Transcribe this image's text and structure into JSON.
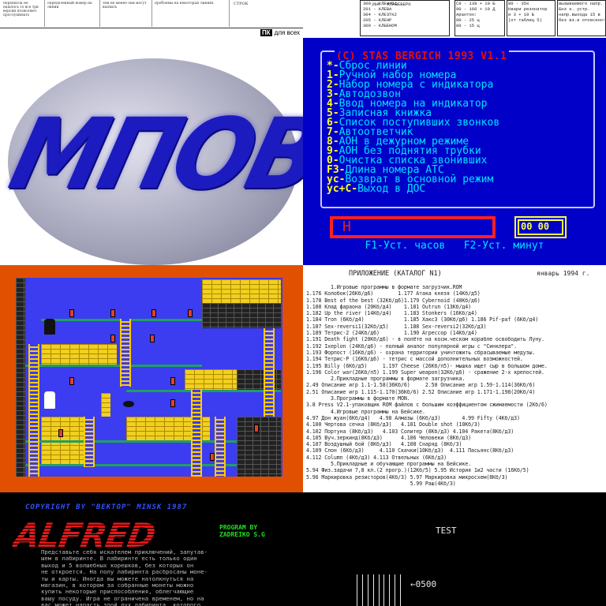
{
  "newsprint": {
    "lines": [
      "переписок не нашлось то все три версии позволяют прослушивать",
      "определенный номер на линии",
      "тем не менее они могут вызвать",
      "проблемы на некоторых линиях"
    ],
    "table_rows": [
      "",
      "",
      "",
      "СТРОК",
      "",
      ""
    ],
    "brand": "ПК",
    "brand_suffix": "для всех"
  },
  "handwritten_table": {
    "col1": [
      "300 - КЛЕН461",
      "201 - КЛЕВА",
      "304 - КЛЕЗТК2",
      "205 - КЛЕНР",
      "309 - КЛБЕНОМ"
    ],
    "col2": [
      "20А - КЛАВЕВЕРО"
    ],
    "col3": [
      "С9 - 139 + 10 Б",
      "90 - 160 + 10 Д",
      "Арантон:",
      "80 - 25 ц",
      "80 - 15 ц"
    ],
    "col4": [
      "80 - 35к",
      "Квари резонатор",
      "и 3 + 10 Б",
      "(от таблиц 5)"
    ],
    "col5": [
      "вызываемого напр.",
      "Бнз к. устр.",
      "напр.выхода 15 в",
      "без вз.и отнесено!"
    ]
  },
  "logo": {
    "text": "МПОВТ"
  },
  "menu": {
    "title": "(C) STAS BERGICH  1993  V1.1",
    "items": [
      {
        "key": "*-",
        "label": "Сброс линии"
      },
      {
        "key": "1-",
        "label": "Ручной набор номера"
      },
      {
        "key": "2-",
        "label": "Набор номера с индикатора"
      },
      {
        "key": "3-",
        "label": "Автодозвон"
      },
      {
        "key": "4-",
        "label": "Ввод номера на индикатор"
      },
      {
        "key": "5-",
        "label": "Записная книжка"
      },
      {
        "key": "6-",
        "label": "Список поступивших звонков"
      },
      {
        "key": "7-",
        "label": "Автоответчик"
      },
      {
        "key": "8-",
        "label": "АОН в дежурном режиме"
      },
      {
        "key": "9-",
        "label": "АОН без поднятия трубки"
      },
      {
        "key": "0-",
        "label": "Очистка списка звонивших"
      },
      {
        "key": "F3-",
        "label": "Длина номера АТС"
      },
      {
        "key": "ус-",
        "label": "Возврат в основной режим"
      },
      {
        "key": "ус+С-",
        "label": "Выход в ДОС"
      }
    ],
    "indicator": "H",
    "clock": "00 00",
    "footer": "F1-Уст. часов   F2-Уст. минут"
  },
  "catalog": {
    "header": "ПРИЛОЖЕНИЕ  (КАТАЛОГ N1)",
    "date": "январь 1994 г.",
    "lines": [
      "        1.Игровые программы в формате загрузчик.ROM",
      "1.176 Колобок(26Кб/д6)        1.177 Атака князя (14Кб/д5)",
      "1.178 Best of the best (32Кб/д6)1.179 Cybernoid (40Кб/д6)",
      "1.180 Клад фараона (20Кб/д4)    1.181 Outrun (13Кб/д4)",
      "1.182 Up the river (14Кб/д4)    1.183 Stonkers (16Кб/д4)",
      "1.184 Tron (6Кб/д4)             1.185 Хакс3 (30Кб/д6) 1.186 Pif-paf (6Кб/д4)",
      "1.187 Sex-reversi1(32Кб/д5)     1.188 Sex-reversi2(32Кб/д3)",
      "1.189 Тетрис-2 (24Кб/д6)        1.190 Агрессор (14Кб/д4)",
      "1.191 Death fight (20Кб/д6) - в полёте на косм.ческом корабле освободить Луну.",
      "1.192 Ixeplon (24Кб/д6) - полный аналог популярной игры с \"Синклера\".",
      "1.193 Форпост (16Кб/д6) - охрана территории уничтожить сбрасываемые медузы.",
      "1.194 Тетрис-Р (16Кб/д6) - тетрис с массой дополнительных возможностей.",
      "1.195 Billy (6Кб/д5)     1.197 Cheese (26Кб/п5)- мышка ищет сыр в большом доме.",
      "1.196 Color war(26Кб/п5) 1.199 Super weapon(32Кб/д6) - сражение 2-х крепостей.",
      "        2.Прикладные программы в формате загрузчика.",
      "2.49 Описание игр 1.1-1.58(36Кб/6)     2.50 Описание игр 1.59-1.114(36Кб/6)",
      "2.51 Описание игр 1.115-1.170(36Кб/6) 2.52 Описание игр 1.171-1.198(20Кб/4)",
      "        3.Программы в формате MON.",
      "3.8 Press V2.1-упаковщик ROM файлов с большим коэффициентом сжимаемости (2Кб/6)",
      "        4.Игровые программы на Бейсике.",
      "4.97 Дон жуан(6Кб/д4)   4.98 Алмазы (6Кб/д3)       4.99 Fifty (4Кб/д3)",
      "4.100 Чертова сечка (8Кб/д3)   4.101 Double shot (10Кб/3)",
      "4.102 Портуна (8Кб/д3)   4.103 Солитер (8Кб/д3) 4.104 Ракета(8Кб/д3)",
      "4.105 Вуч.зеркинд(8Кб/д3)      4.106 Человеки (8Кб/д3)",
      "4.107 Воздушный бой (8Кб/д3)   4.108 Снаряд (8Кб/3)",
      "4.109 Слон (6Кб/д3)     4.110 Скачки(10Кб/д3)  4.111 Пасьянс(8Кб/д3)",
      "4.112 Column (4Кб/д3) 4.113 Отвельных (6Кб/д3)",
      "        5.Прикладные и обучающие программы на Бейсике.",
      "5.94 Физ.задачи 7,8 кл.(2 прогр.)(12Кб/5) 5.95 История 1и2 части (16Кб/5)",
      "5.96 Маркировка резисторов(4Кб/3) 5.97 Маркировка микросхем(8Кб/3)",
      "                                  5.99 Раш(4Кб/3)"
    ]
  },
  "alfred": {
    "copyright": "COPYRIGHT BY \"BEKTOP\" MINSK 1987",
    "title": "ALFRED",
    "credits": [
      "PROGRAM BY",
      "ZADREIKO S.G"
    ],
    "story": [
      "Представьте себя искателем приключений, запутав-",
      "шем в лабиринте. В лабиринте есть только один",
      "выход и 5 волшебных корешков, без которых он",
      "не откроется. На полу лабиринта расбросаны моне-",
      "ты и карты. Иногда вы можете натолкнуться на",
      "магазин, в котором за собранные монеты можно",
      "купить некоторые приспособления, облегчающие",
      "вашу посуду. Игра не ограничена временем, но на",
      "вас может напасть злой дух лабиринта, которого"
    ]
  },
  "test": {
    "title": "TEST",
    "pointer": "←0500"
  }
}
